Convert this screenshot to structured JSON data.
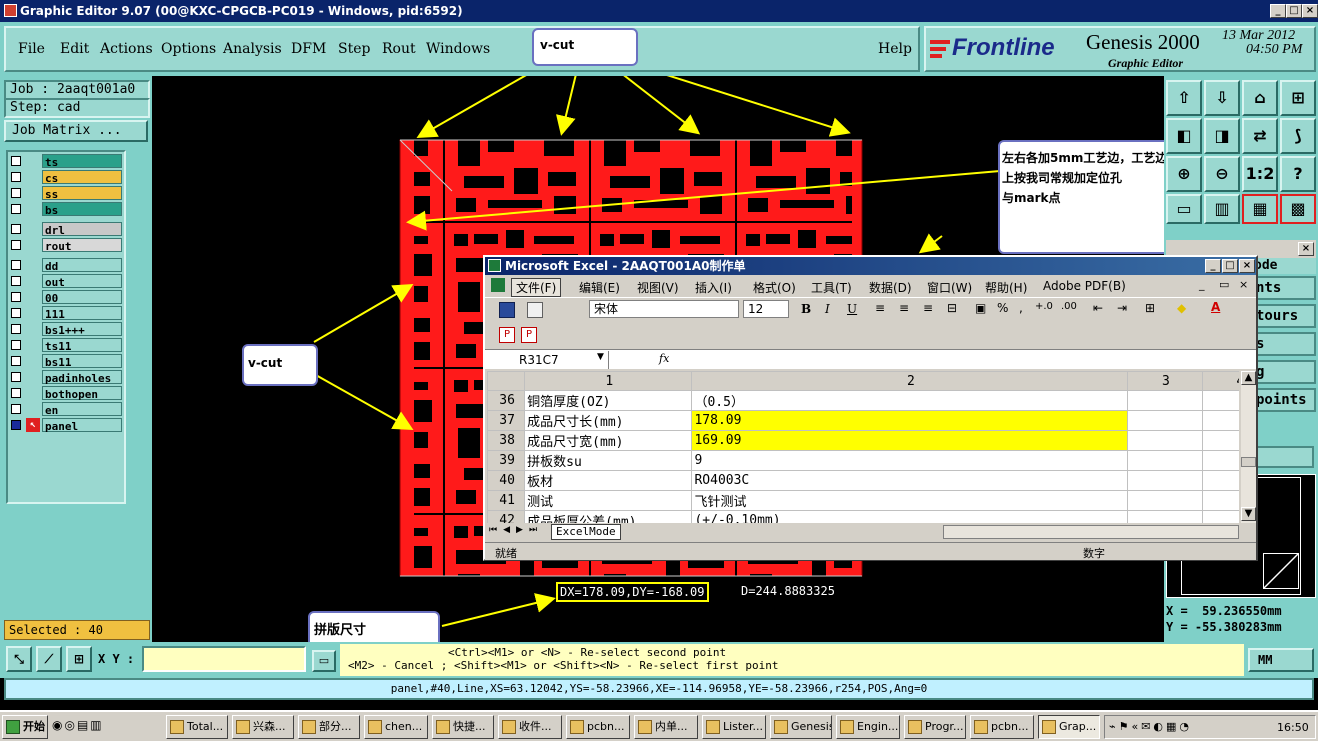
{
  "window": {
    "title": "Graphic Editor 9.07 (00@KXC-CPGCB-PC019 - Windows, pid:6592)"
  },
  "menu": [
    "File",
    "Edit",
    "Actions",
    "Options",
    "Analysis",
    "DFM",
    "Step",
    "Rout",
    "Windows"
  ],
  "help_label": "Help",
  "logo": {
    "brand": "Frontline",
    "product": "Genesis 2000",
    "subtitle": "Graphic Editor",
    "date": "13 Mar 2012",
    "time": "04:50 PM"
  },
  "job": {
    "job_label": "Job : 2aaqt001a0",
    "step_label": "Step: cad",
    "matrix_button": "Job Matrix ..."
  },
  "layers": [
    {
      "name": "ts",
      "color": "#2aa08a"
    },
    {
      "name": "cs",
      "color": "#f0c040"
    },
    {
      "name": "ss",
      "color": "#f0c040"
    },
    {
      "name": "bs",
      "color": "#2aa08a"
    },
    {
      "name": "drl",
      "color": "#c8c8c8"
    },
    {
      "name": "rout",
      "color": "#d8d8d8"
    },
    {
      "name": "dd",
      "color": "#9ad8d0"
    },
    {
      "name": "out",
      "color": "#9ad8d0"
    },
    {
      "name": "00",
      "color": "#9ad8d0"
    },
    {
      "name": "111",
      "color": "#9ad8d0"
    },
    {
      "name": "bs1+++",
      "color": "#9ad8d0"
    },
    {
      "name": "ts11",
      "color": "#9ad8d0"
    },
    {
      "name": "bs11",
      "color": "#9ad8d0"
    },
    {
      "name": "padinholes",
      "color": "#9ad8d0"
    },
    {
      "name": "bothopen",
      "color": "#9ad8d0"
    },
    {
      "name": "en",
      "color": "#9ad8d0"
    },
    {
      "name": "panel",
      "color": "#9ad8d0"
    }
  ],
  "selected": "Selected : 40",
  "callouts": {
    "vcut_top": "v-cut",
    "vcut_left": "v-cut",
    "note": [
      "左右各加5mm工艺边，工艺边",
      "上按我司常规加定位孔",
      "与mark点"
    ],
    "panel_size": "拼版尺寸"
  },
  "measure": {
    "dxdy": "DX=178.09,DY=-168.09",
    "dist": "D=244.8883325"
  },
  "right_panel": {
    "partial_labels": [
      "ode",
      "nts",
      "tours",
      "s",
      "g",
      "points"
    ],
    "coord_x": "X =  59.236550mm",
    "coord_y": "Y = -55.380283mm",
    "units": "MM"
  },
  "xy_label": "X Y :",
  "prompt_line1": "<Ctrl><M1> or <N> - Re-select second point",
  "prompt_line2": "<M2> - Cancel ; <Shift><M1> or <Shift><N> - Re-select first point",
  "status_line": "panel,#40,Line,XS=63.12042,YS=-58.23966,XE=-114.96958,YE=-58.23966,r254,POS,Ang=0",
  "excel": {
    "title": "Microsoft Excel - 2AAQT001A0制作单",
    "menus": [
      "文件(F)",
      "编辑(E)",
      "视图(V)",
      "插入(I)",
      "格式(O)",
      "工具(T)",
      "数据(D)",
      "窗口(W)",
      "帮助(H)",
      "Adobe PDF(B)"
    ],
    "font": "宋体",
    "font_size": "12",
    "cell_ref": "R31C7",
    "fx": "fx",
    "col_headers": [
      "1",
      "2",
      "3",
      "4"
    ],
    "rows": [
      {
        "num": "36",
        "label": "铜箔厚度(OZ)",
        "value": "（0.5）",
        "highlight": false
      },
      {
        "num": "37",
        "label": "成品尺寸长(mm)",
        "value": "178.09",
        "highlight": true
      },
      {
        "num": "38",
        "label": "成品尺寸宽(mm)",
        "value": "169.09",
        "highlight": true
      },
      {
        "num": "39",
        "label": "拼板数su",
        "value": "9",
        "highlight": false
      },
      {
        "num": "40",
        "label": "板材",
        "value": "RO4003C",
        "highlight": false
      },
      {
        "num": "41",
        "label": "测试",
        "value": "飞针测试",
        "highlight": false
      },
      {
        "num": "42",
        "label": "成品板厚公差(mm)",
        "value": "(+/-0.10mm)",
        "highlight": false
      }
    ],
    "sheet_tab": "ExcelMode",
    "status_ready": "就绪",
    "status_num": "数字"
  },
  "taskbar": {
    "start": "开始",
    "tasks": [
      "Total...",
      "兴森...",
      "部分...",
      "chen...",
      "快捷...",
      "收件...",
      "pcbn...",
      "内单...",
      "Lister...",
      "Genesis",
      "Engin...",
      "Progr...",
      "pcbn...",
      "Grap..."
    ],
    "clock": "16:50"
  },
  "colors": {
    "accent": "#7fd0c8",
    "pcb_red": "#ff1a1a",
    "title_blue": "#0a246a",
    "highlight_yellow": "#ffff00"
  }
}
